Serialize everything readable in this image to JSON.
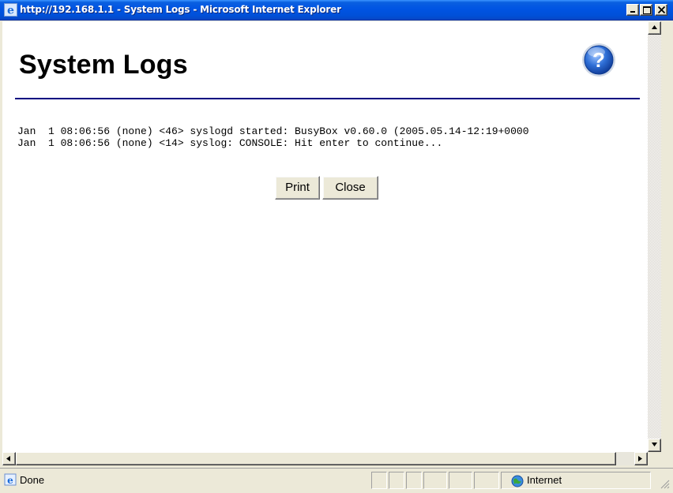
{
  "window": {
    "title": "http://192.168.1.1 - System Logs - Microsoft Internet Explorer"
  },
  "page": {
    "title": "System Logs",
    "log_lines": [
      "Jan  1 08:06:56 (none) <46> syslogd started: BusyBox v0.60.0 (2005.05.14-12:19+0000",
      "Jan  1 08:06:56 (none) <14> syslog: CONSOLE: Hit enter to continue..."
    ],
    "buttons": {
      "print": "Print",
      "close": "Close"
    }
  },
  "statusbar": {
    "status_text": "Done",
    "zone_text": "Internet"
  },
  "icons": {
    "window": "ie-icon",
    "help": "help-icon",
    "status": "ie-page-icon",
    "zone": "globe-icon"
  },
  "colors": {
    "titlebar": "#0054e3",
    "rule": "#000080",
    "help_icon": "#2f6fd6"
  }
}
